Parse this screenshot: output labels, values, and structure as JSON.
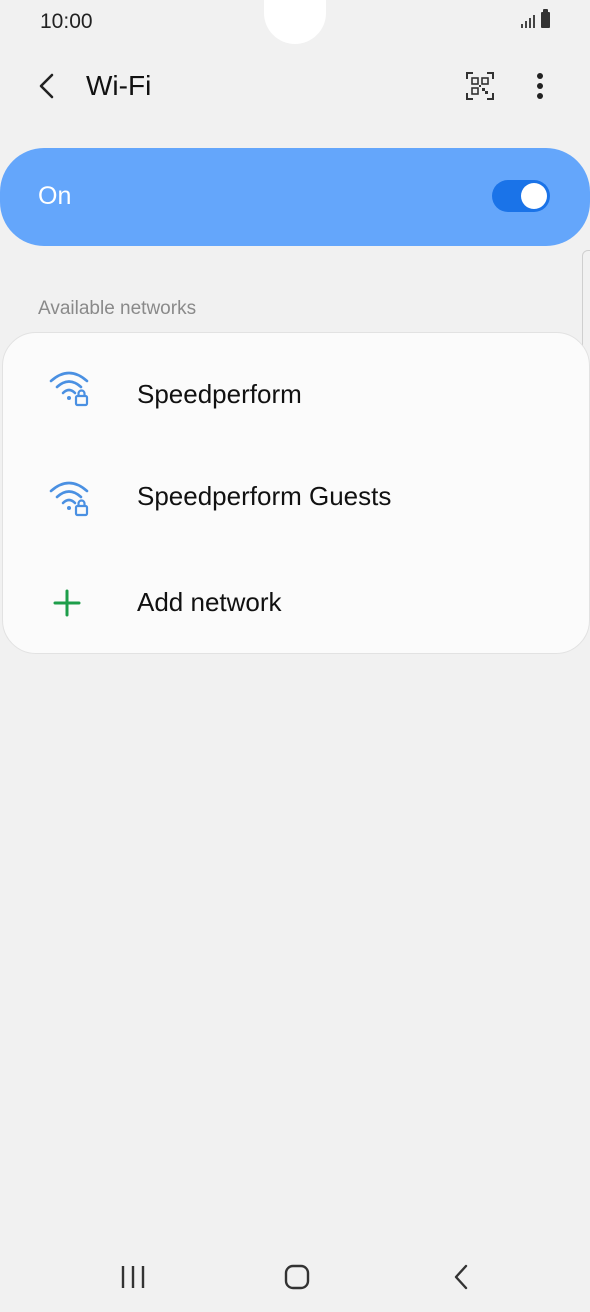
{
  "status_bar": {
    "time": "10:00",
    "icons": [
      "signal-icon",
      "battery-icon"
    ]
  },
  "app_bar": {
    "title": "Wi-Fi",
    "icons": [
      "back-arrow-icon",
      "qr-code-icon",
      "more-vertical-icon"
    ]
  },
  "wifi_toggle": {
    "label": "On",
    "state": "on",
    "accent_color": "#64a6fb"
  },
  "available_networks": {
    "header": "Available networks",
    "items": [
      {
        "name": "Speedperform",
        "icon": "wifi-lock-icon",
        "color": "#4a90e2"
      },
      {
        "name": "Speedperform Guests",
        "icon": "wifi-lock-icon",
        "color": "#4a90e2"
      },
      {
        "name": "Add network",
        "icon": "plus-icon",
        "color": "#1e9e4a"
      }
    ]
  },
  "nav_bar": {
    "icons": [
      "recents-icon",
      "home-icon",
      "back-icon"
    ]
  }
}
